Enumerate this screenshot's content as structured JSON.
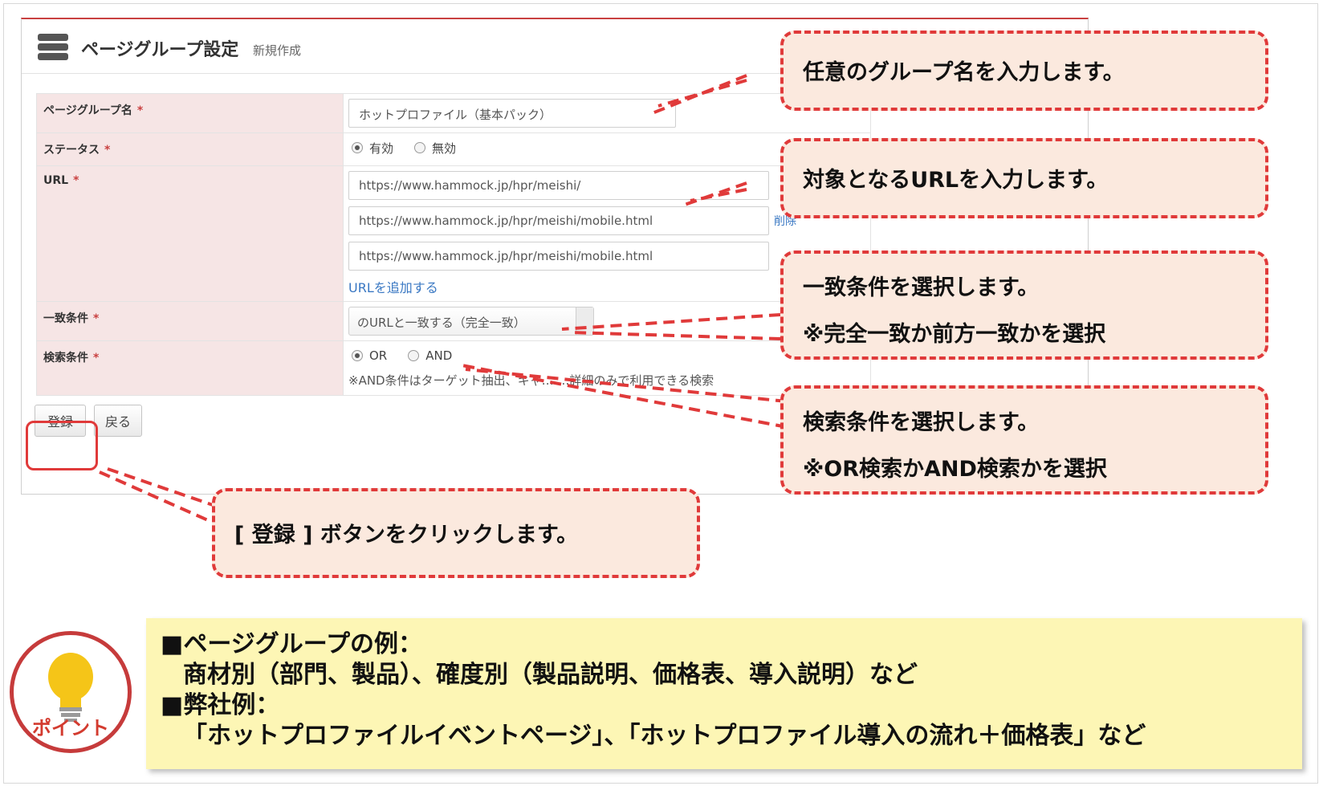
{
  "form": {
    "title": "ページグループ設定",
    "subtitle": "新規作成",
    "rows": {
      "group_name": {
        "label": "ページグループ名",
        "value": "ホットプロファイル（基本パック）"
      },
      "status": {
        "label": "ステータス",
        "option_on": "有効",
        "option_off": "無効"
      },
      "url": {
        "label": "URL",
        "values": [
          "https://www.hammock.jp/hpr/meishi/",
          "https://www.hammock.jp/hpr/meishi/mobile.html",
          "https://www.hammock.jp/hpr/meishi/mobile.html"
        ],
        "delete_label": "削除",
        "add_label": "URLを追加する"
      },
      "match": {
        "label": "一致条件",
        "selected": "のURLと一致する（完全一致）"
      },
      "search": {
        "label": "検索条件",
        "option_or": "OR",
        "option_and": "AND",
        "note": "※AND条件はターゲット抽出、キャ… …詳細のみで利用できる検索"
      }
    },
    "required_mark": "*",
    "buttons": {
      "register": "登録",
      "back": "戻る"
    }
  },
  "callouts": {
    "group_name": [
      "任意のグループ名を入力します。"
    ],
    "url": [
      "対象となるURLを入力します。"
    ],
    "match": [
      "一致条件を選択します。",
      "※完全一致か前方一致かを選択"
    ],
    "search": [
      "検索条件を選択します。",
      "※OR検索かAND検索かを選択"
    ],
    "register": [
      "[ 登録 ] ボタンをクリックします。"
    ]
  },
  "point": {
    "badge_label": "ポイント",
    "lines": [
      "■ページグループの例：",
      "商材別（部門、製品）、確度別（製品説明、価格表、導入説明）など",
      "■弊社例：",
      "「ホットプロファイルイベントページ」、「ホットプロファイル導入の流れ＋価格表」など"
    ]
  },
  "colors": {
    "accent_red": "#e03a3a",
    "callout_bg": "#fbe9de",
    "label_bg": "#f6e5e5",
    "point_bg": "#fdf6b5",
    "link_blue": "#3a78c3"
  },
  "icons": [
    "stack-icon",
    "lightbulb-icon"
  ]
}
